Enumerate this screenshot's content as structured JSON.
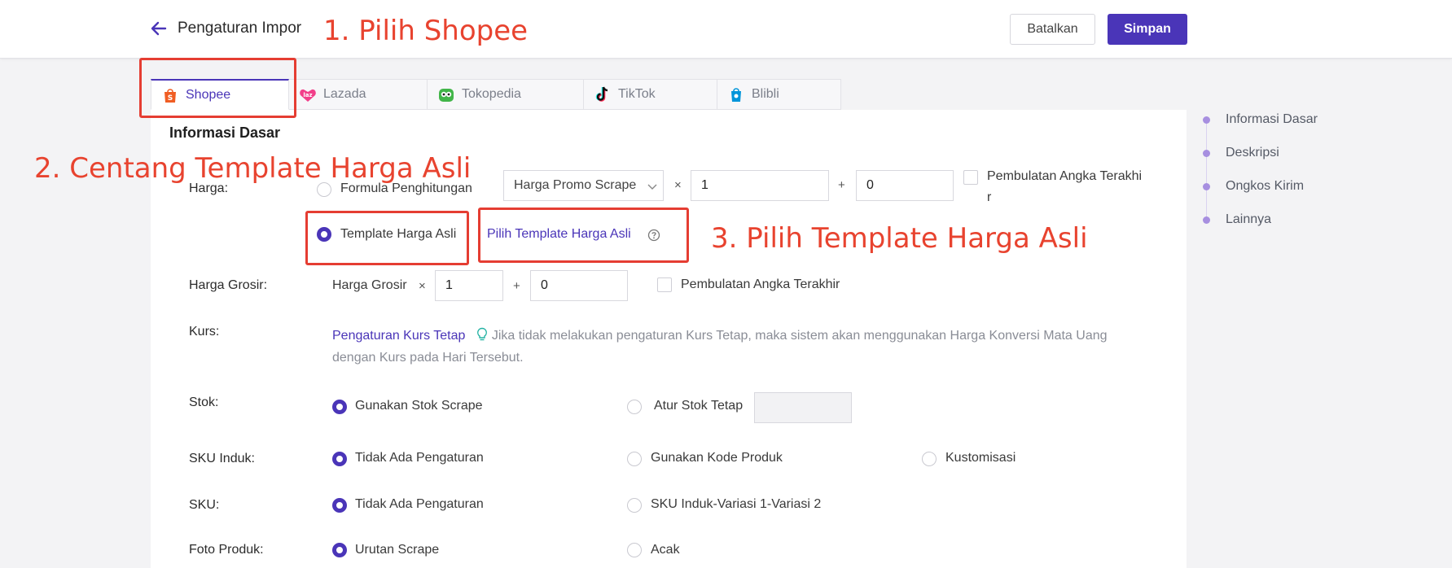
{
  "header": {
    "title": "Pengaturan Impor",
    "cancel_label": "Batalkan",
    "save_label": "Simpan"
  },
  "tabs": [
    {
      "label": "Shopee",
      "icon": "shopee-icon",
      "active": true
    },
    {
      "label": "Lazada",
      "icon": "lazada-icon",
      "active": false
    },
    {
      "label": "Tokopedia",
      "icon": "tokopedia-icon",
      "active": false
    },
    {
      "label": "TikTok",
      "icon": "tiktok-icon",
      "active": false
    },
    {
      "label": "Blibli",
      "icon": "blibli-icon",
      "active": false
    }
  ],
  "form": {
    "section_title": "Informasi Dasar",
    "harga": {
      "label": "Harga:",
      "formula_label": "Formula Penghitungan",
      "select_value": "Harga Promo Scrape",
      "multiply_symbol": "×",
      "multiplier": "1",
      "plus_symbol": "+",
      "addend": "0",
      "rounding_label_line1": "Pembulatan Angka Terakhi",
      "rounding_label_line2": "r",
      "template_label": "Template Harga Asli",
      "template_link": "Pilih Template Harga Asli"
    },
    "harga_grosir": {
      "label": "Harga Grosir:",
      "field_label": "Harga Grosir",
      "multiply_symbol": "×",
      "multiplier": "1",
      "plus_symbol": "+",
      "addend": "0",
      "rounding_label": "Pembulatan Angka Terakhir"
    },
    "kurs": {
      "label": "Kurs:",
      "link": "Pengaturan Kurs Tetap",
      "hint_line1": "Jika tidak melakukan pengaturan Kurs Tetap, maka sistem akan menggunakan Harga Konversi Mata Uang",
      "hint_line2": "dengan Kurs pada Hari Tersebut."
    },
    "stok": {
      "label": "Stok:",
      "option1": "Gunakan Stok Scrape",
      "option2": "Atur Stok Tetap"
    },
    "sku_induk": {
      "label": "SKU Induk:",
      "option1": "Tidak Ada Pengaturan",
      "option2": "Gunakan Kode Produk",
      "option3": "Kustomisasi"
    },
    "sku": {
      "label": "SKU:",
      "option1": "Tidak Ada Pengaturan",
      "option2": "SKU Induk-Variasi 1-Variasi 2"
    },
    "foto_produk": {
      "label": "Foto Produk:",
      "option1": "Urutan Scrape",
      "option2": "Acak"
    }
  },
  "side_nav": [
    "Informasi Dasar",
    "Deskripsi",
    "Ongkos Kirim",
    "Lainnya"
  ],
  "annotations": {
    "step1": "1. Pilih Shopee",
    "step2": "2. Centang Template Harga Asli",
    "step3": "3. Pilih Template Harga Asli"
  },
  "colors": {
    "accent": "#4a35b8",
    "annotation_red": "#e53d32"
  }
}
